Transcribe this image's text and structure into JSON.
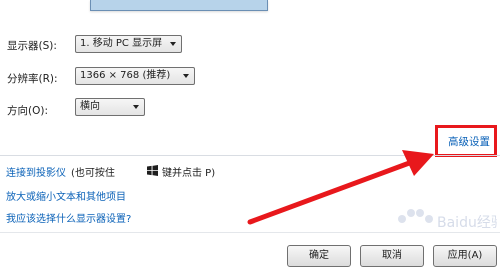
{
  "display_row": {
    "label": "显示器(S):",
    "value": "1. 移动 PC 显示屏"
  },
  "resolution_row": {
    "label": "分辨率(R):",
    "value": "1366 × 768 (推荐)"
  },
  "orientation_row": {
    "label": "方向(O):",
    "value": "横向"
  },
  "advanced_settings_link": "高级设置",
  "projector_link": "连接到投影仪",
  "projector_hint_prefix": "(也可按住",
  "projector_hint_suffix": "键并点击 P)",
  "text_size_link": "放大或缩小文本和其他项目",
  "which_settings_link": "我应该选择什么显示器设置?",
  "buttons": {
    "ok": "确定",
    "cancel": "取消",
    "apply": "应用(A)"
  },
  "watermark_text": "Baidu经验",
  "colors": {
    "link": "#0b62b8",
    "highlight": "#e8181c"
  }
}
